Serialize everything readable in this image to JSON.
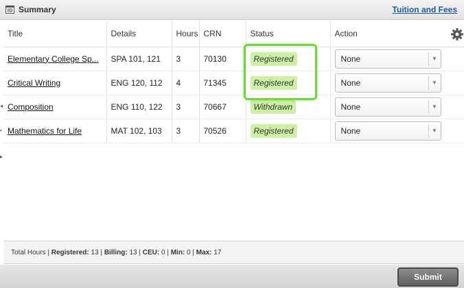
{
  "header": {
    "title": "Summary",
    "tuition_link": "Tuition and Fees"
  },
  "table": {
    "columns": [
      "Title",
      "Details",
      "Hours",
      "CRN",
      "Status",
      "Action"
    ],
    "rows": [
      {
        "title": "Elementary College Sp...",
        "details": "SPA 101, 121",
        "hours": "3",
        "crn": "70130",
        "status": "Registered",
        "action": "None"
      },
      {
        "title": "Critical Writing",
        "details": "ENG 120, 112",
        "hours": "4",
        "crn": "71345",
        "status": "Registered",
        "action": "None"
      },
      {
        "title": "Composition",
        "details": "ENG 110, 122",
        "hours": "3",
        "crn": "70667",
        "status": "Withdrawn",
        "action": "None"
      },
      {
        "title": "Mathematics for Life",
        "details": "MAT 102, 103",
        "hours": "3",
        "crn": "70526",
        "status": "Registered",
        "action": "None"
      }
    ]
  },
  "totals": {
    "label": "Total Hours",
    "registered_label": "Registered:",
    "registered": "13",
    "billing_label": "Billing:",
    "billing": "13",
    "ceu_label": "CEU:",
    "ceu": "0",
    "min_label": "Min:",
    "min": "0",
    "max_label": "Max:",
    "max": "17"
  },
  "footer": {
    "submit_label": "Submit"
  },
  "colors": {
    "status_bg": "#cdf0a4",
    "highlight": "#76d245",
    "link": "#1f5a98"
  }
}
